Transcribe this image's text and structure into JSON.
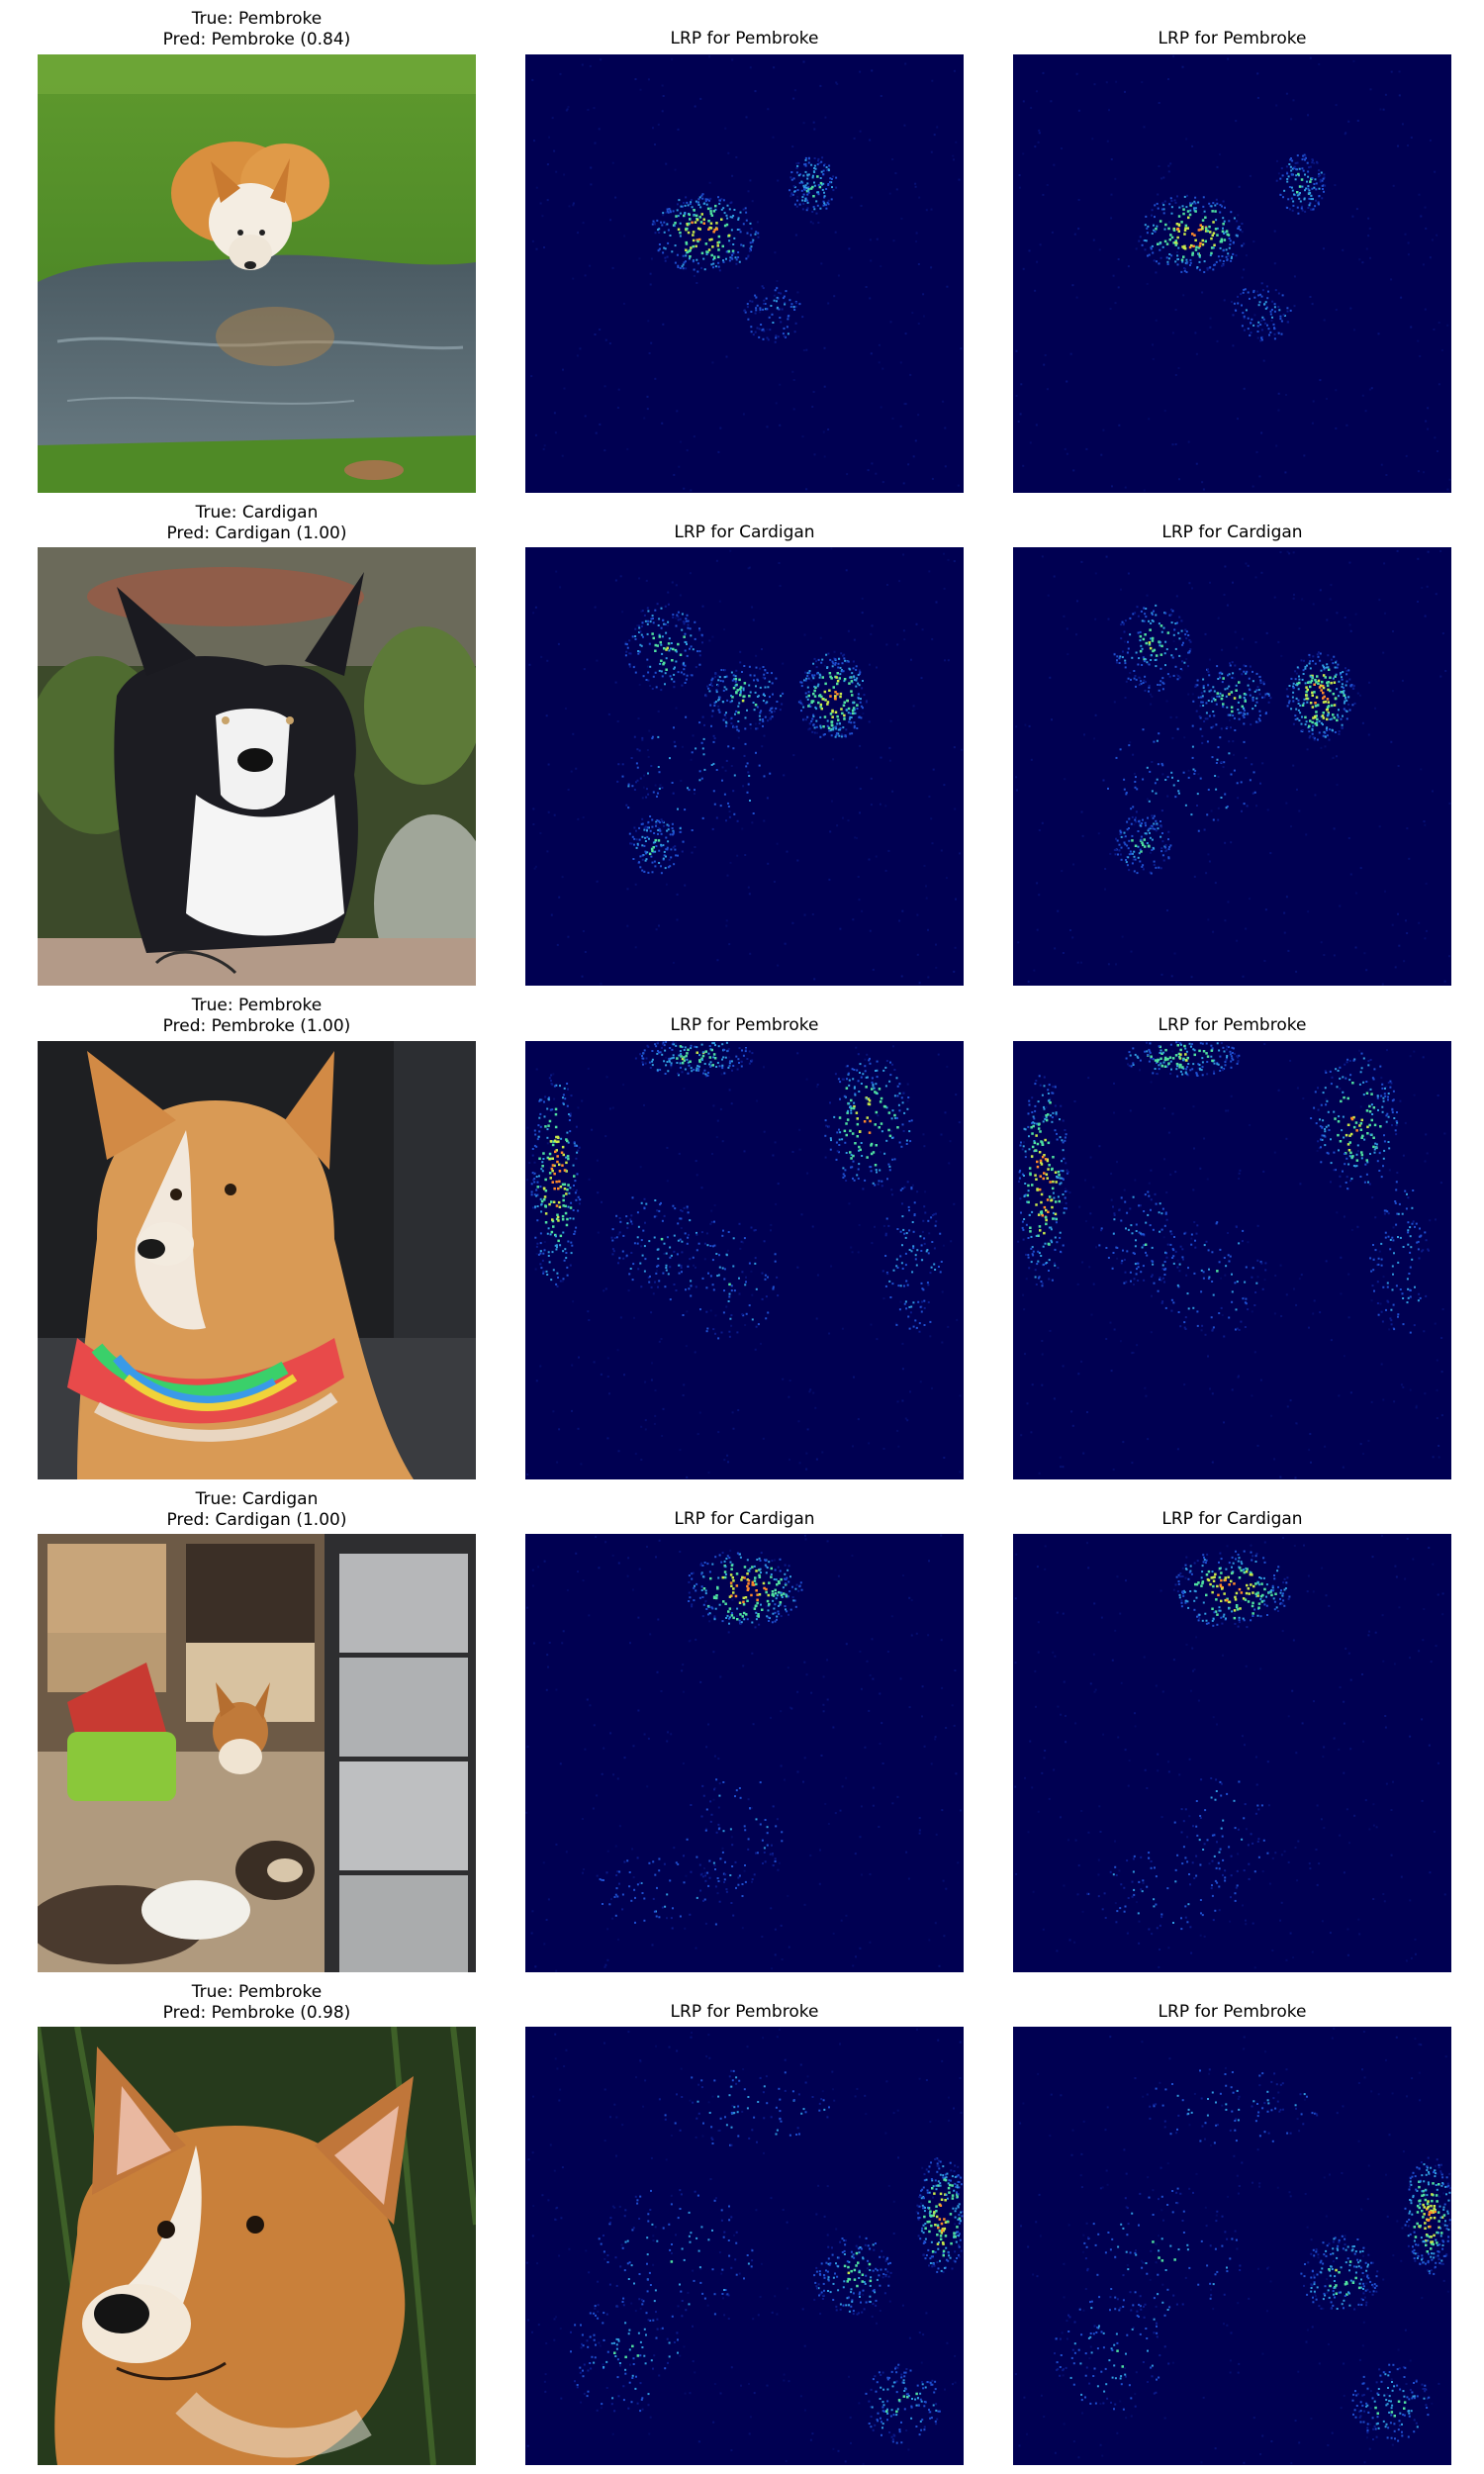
{
  "figure": {
    "heatmap_background": "#000052",
    "heatmap_palette": [
      "#0a1a8a",
      "#1e4fd0",
      "#2f9be0",
      "#4fe0a0",
      "#c8e84a",
      "#ff8a2a"
    ]
  },
  "rows": [
    {
      "true_label": "True: Pembroke",
      "pred_label": "Pred: Pembroke (0.84)",
      "lrp_title_1": "LRP for Pembroke",
      "lrp_title_2": "LRP for Pembroke",
      "photo_subject": "corgi drinking from puddle on grass"
    },
    {
      "true_label": "True: Cardigan",
      "pred_label": "Pred: Cardigan (1.00)",
      "lrp_title_1": "LRP for Cardigan",
      "lrp_title_2": "LRP for Cardigan",
      "photo_subject": "black and white corgi sitting in garden"
    },
    {
      "true_label": "True: Pembroke",
      "pred_label": "Pred: Pembroke (1.00)",
      "lrp_title_1": "LRP for Pembroke",
      "lrp_title_2": "LRP for Pembroke",
      "photo_subject": "corgi wearing colorful ruffle collar"
    },
    {
      "true_label": "True: Cardigan",
      "pred_label": "Pred: Cardigan (1.00)",
      "lrp_title_1": "LRP for Cardigan",
      "lrp_title_2": "LRP for Cardigan",
      "photo_subject": "corgi and cat in cluttered room"
    },
    {
      "true_label": "True: Pembroke",
      "pred_label": "Pred: Pembroke (0.98)",
      "lrp_title_1": "LRP for Pembroke",
      "lrp_title_2": "LRP for Pembroke",
      "photo_subject": "close-up of corgi face"
    }
  ]
}
